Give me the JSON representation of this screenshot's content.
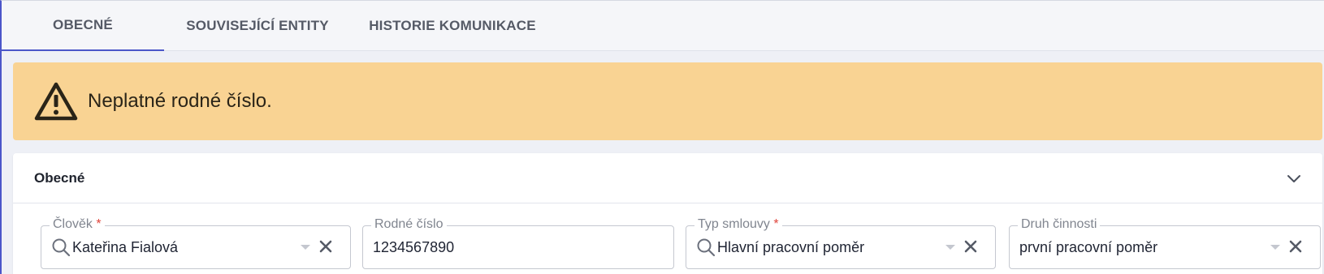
{
  "tabs": [
    {
      "label": "OBECNÉ",
      "active": true
    },
    {
      "label": "SOUVISEJÍCÍ ENTITY",
      "active": false
    },
    {
      "label": "HISTORIE KOMUNIKACE",
      "active": false
    }
  ],
  "alert": {
    "message": "Neplatné rodné číslo.",
    "icon": "warning-icon",
    "background": "#f9d393"
  },
  "section": {
    "title": "Obecné",
    "icon": "chevron-down-icon"
  },
  "fields": {
    "person": {
      "label": "Člověk",
      "required_mark": "*",
      "value": "Kateřina Fialová"
    },
    "birth_number": {
      "label": "Rodné číslo",
      "value": "1234567890"
    },
    "contract_type": {
      "label": "Typ smlouvy",
      "required_mark": "*",
      "value": "Hlavní pracovní poměr"
    },
    "activity_type": {
      "label": "Druh činnosti",
      "value": "první pracovní poměr"
    }
  },
  "colors": {
    "accent": "#4b56c9",
    "required": "#e0453c",
    "warning": "#f9d393"
  }
}
